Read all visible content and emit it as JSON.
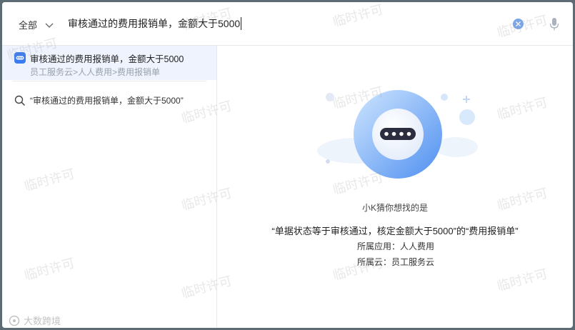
{
  "search": {
    "scope_label": "全部",
    "query": "审核通过的费用报销单，金额大于5000"
  },
  "suggestion": {
    "title": "审核通过的费用报销单，金额大于5000",
    "path": "员工服务云>人人费用>费用报销单"
  },
  "search_option": {
    "text": "“审核通过的费用报销单，金额大于5000”"
  },
  "result": {
    "guess_label": "小K猜你想找的是",
    "answer": "“单据状态等于审核通过，核定金额大于5000”的“费用报销单”",
    "app_line": "所属应用：人人费用",
    "cloud_line": "所属云：员工服务云"
  },
  "watermark": {
    "text": "临时许可"
  },
  "corner_logo": {
    "text": "大数跨境"
  },
  "colors": {
    "accent": "#3b7cf0",
    "selected_bg": "#eef3fd",
    "muted_text": "#9aa1aa"
  }
}
